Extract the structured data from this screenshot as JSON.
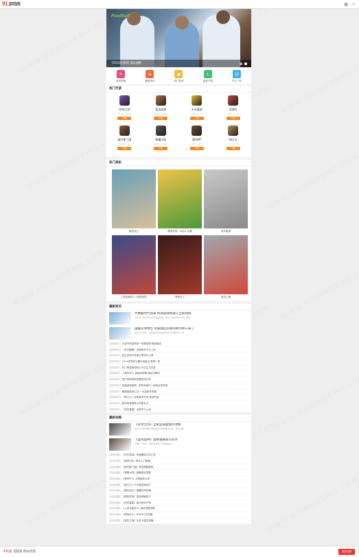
{
  "header": {
    "logo_number": "91",
    "logo_text": "游戏网",
    "icon_grid": "grid-icon",
    "icon_share": "share-icon"
  },
  "banner": {
    "badge": "Football",
    "caption": "[2014世界杯] 球队前瞻",
    "dots": 2,
    "active_dot": 1
  },
  "quicknav": {
    "items": [
      {
        "label": "游戏攻略",
        "color": "#e84c7c",
        "icon": "edit-icon"
      },
      {
        "label": "最新资讯",
        "color": "#ef6c3a",
        "icon": "news-icon"
      },
      {
        "label": "热门游戏",
        "color": "#f5b83a",
        "icon": "gamepad-icon"
      },
      {
        "label": "高速下载",
        "color": "#43c07a",
        "icon": "download-icon"
      },
      {
        "label": "开心一刻",
        "color": "#3eaee5",
        "icon": "smile-icon"
      }
    ]
  },
  "apps": {
    "title": "热门手游",
    "button_label": "下载",
    "items": [
      {
        "name": "苍穹之剑",
        "size": "10.8M | 1.3万",
        "color": "#7a4fb0"
      },
      {
        "name": "混沌战神",
        "size": "48.6M | 4568",
        "color": "#b0713a"
      },
      {
        "name": "天天富翁",
        "size": "25M | 1.5万",
        "color": "#e8b634"
      },
      {
        "name": "武侠Q",
        "size": "8M | 1.1万",
        "color": "#c2463a"
      },
      {
        "name": "放开那三国",
        "size": "76.8M | 4万",
        "color": "#8a5a2e"
      },
      {
        "name": "神魔大陆",
        "size": "62M | 2.9万",
        "color": "#4a5560"
      },
      {
        "name": "我叫MT",
        "size": "52M | 2.5万",
        "color": "#6b4a2c"
      },
      {
        "name": "神之刃",
        "size": "111M | 2万",
        "color": "#b58a4a"
      }
    ]
  },
  "games": {
    "title": "热门单机",
    "items": [
      {
        "name": "魔幻战士",
        "c1": "#6aa0b8",
        "c2": "#d7c09a"
      },
      {
        "name": "模拟农场：16合1 合集",
        "c1": "#f0c24a",
        "c2": "#4a9a3a"
      },
      {
        "name": "消灭星星",
        "c1": "#c9c9c9",
        "c2": "#8a8a8a"
      },
      {
        "name": "上帝也疯狂2 人类的祖先",
        "c1": "#3a4a8a",
        "c2": "#c0483a"
      },
      {
        "name": "愤怒巨人",
        "c1": "#3a1a1a",
        "c2": "#a03a2a"
      },
      {
        "name": "复仇之魂",
        "c1": "#a0a8b0",
        "c2": "#d0483a"
      }
    ]
  },
  "news": {
    "title": "最新资讯",
    "features": [
      {
        "title": "大数据时代到来 移动游戏将进入全新领域",
        "desc": "近年来，移动游戏市场发展迅速，各大厂商纷纷加大投入布局...",
        "color": "#7ab0d8"
      },
      {
        "title": "国服公测预告 玩家翘首以盼的新作终于来了",
        "desc": "官方今日宣布，这款备受关注的新作将于近期开启公测...",
        "color": "#8bb8d8"
      }
    ],
    "rows": [
      {
        "tag": "[游戏资讯]",
        "text": "手游市场迎来新一轮爆发期 精品频出"
      },
      {
        "tag": "[游戏资讯]",
        "text": "《天天酷跑》全新版本今日上线"
      },
      {
        "tag": "[游戏资讯]",
        "text": "独立游戏开发者分享成长心得"
      },
      {
        "tag": "[游戏资讯]",
        "text": "2014世界杯主题手游盘点 推荐一览"
      },
      {
        "tag": "[游戏资讯]",
        "text": "热门网游新资料片今日正式开放"
      },
      {
        "tag": "[游戏资讯]",
        "text": "《我叫MT》新版本前瞻 新玩法曝光"
      },
      {
        "tag": "[游戏资讯]",
        "text": "国产单机游戏发展现状分析"
      },
      {
        "tag": "[游戏资讯]",
        "text": "经典游戏回顾：那些年我们一起玩过的游戏"
      },
      {
        "tag": "[游戏资讯]",
        "text": "暑期档新游汇总 一大波新作来袭"
      },
      {
        "tag": "[游戏资讯]",
        "text": "《神之刃》全新副本开放 挑战升级"
      },
      {
        "tag": "[游戏资讯]",
        "text": "移动电竞赛事火热报名中"
      },
      {
        "tag": "[游戏资讯]",
        "text": "《消灭星星》全新关卡上线"
      }
    ]
  },
  "guides": {
    "title": "最新攻略",
    "features": [
      {
        "title": "《苍穹之剑》全职业技能加点攻略",
        "desc": "本文为大家详细介绍各职业的技能加点方案，新手必看...",
        "color": "#4a4a4a"
      },
      {
        "title": "《混沌战神》副本通关技巧分享",
        "desc": "掌握以下技巧，轻松通关各个高难度副本...",
        "color": "#5a4a3a"
      }
    ],
    "rows": [
      {
        "tag": "[游戏攻略]",
        "text": "《天天富翁》快速赚钱方法汇总"
      },
      {
        "tag": "[游戏攻略]",
        "text": "《武侠Q传》新手入门指南"
      },
      {
        "tag": "[游戏攻略]",
        "text": "《放开那三国》阵容搭配推荐"
      },
      {
        "tag": "[游戏攻略]",
        "text": "《神魔大陆》装备强化攻略"
      },
      {
        "tag": "[游戏攻略]",
        "text": "《我叫MT》卡牌培养心得"
      },
      {
        "tag": "[游戏攻略]",
        "text": "《神之刃》PVP竞技场技巧"
      },
      {
        "tag": "[游戏攻略]",
        "text": "《魔幻战士》隐藏任务攻略"
      },
      {
        "tag": "[游戏攻略]",
        "text": "《模拟农场》高效种植技巧"
      },
      {
        "tag": "[游戏攻略]",
        "text": "《消灭星星》高分秘诀分享"
      },
      {
        "tag": "[游戏攻略]",
        "text": "《上帝也疯狂2》通关流程详解"
      },
      {
        "tag": "[游戏攻略]",
        "text": "《愤怒巨人》BOSS打法攻略"
      },
      {
        "tag": "[游戏攻略]",
        "text": "《复仇之魂》全关卡图文攻略"
      }
    ]
  },
  "footer": {
    "link_mobile": "手机版",
    "link_pc": "电脑版",
    "link_site": "网站地图",
    "login_label": "返回顶部"
  },
  "watermark": "WWW.DOWNDEMO.COM",
  "colors": {
    "brand": "#e53935",
    "download_button": "#f08a24"
  }
}
